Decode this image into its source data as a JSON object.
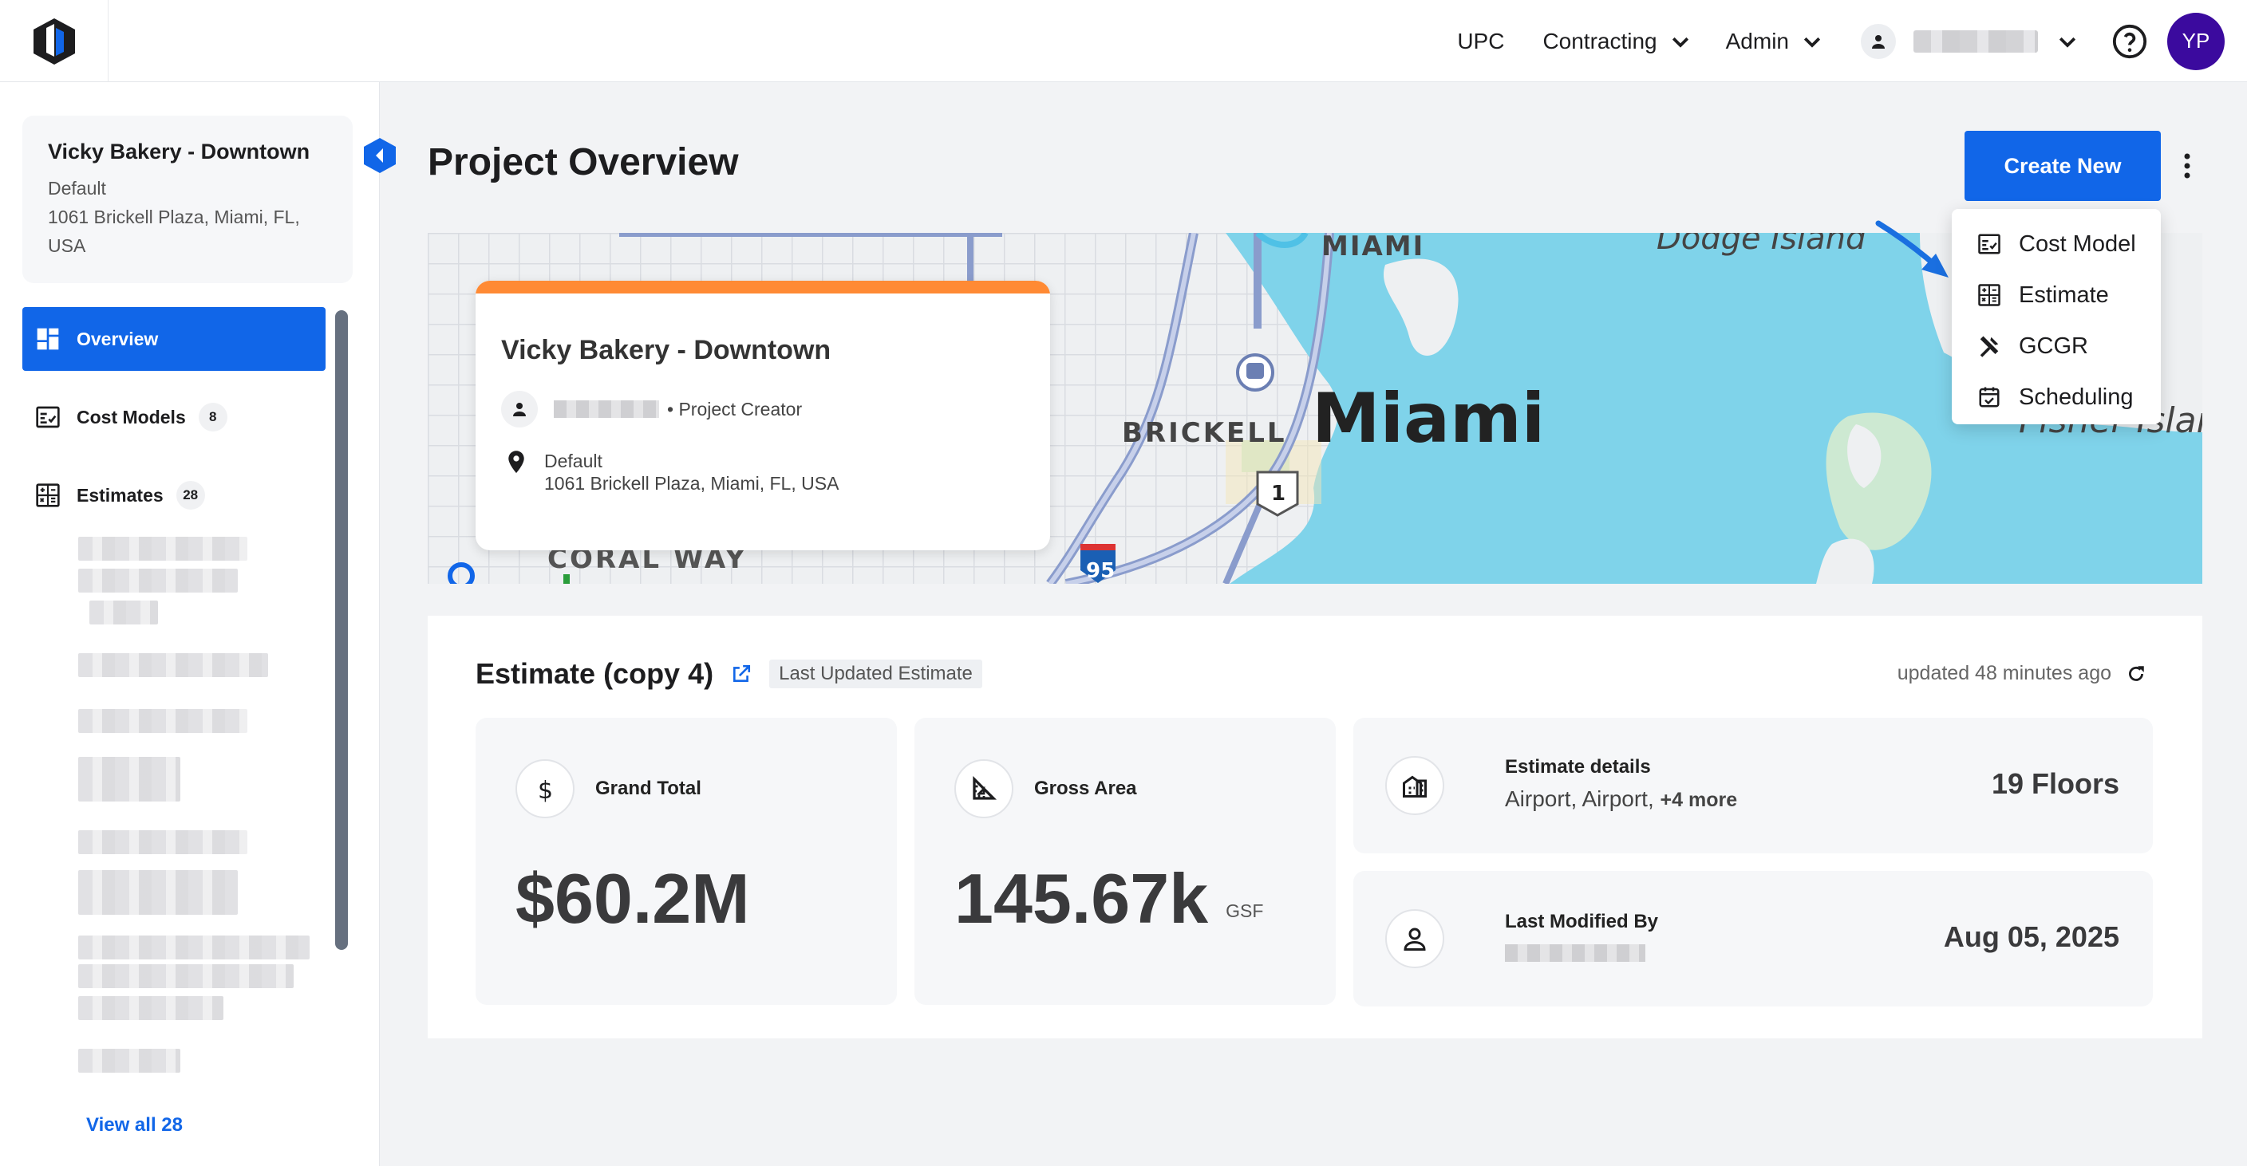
{
  "topbar": {
    "logo": "logo-icon",
    "nav": {
      "upc": "UPC",
      "contracting": "Contracting",
      "admin": "Admin"
    },
    "avatar_initials": "YP"
  },
  "sidebar": {
    "project": {
      "name": "Vicky Bakery - Downtown",
      "category": "Default",
      "address": "1061 Brickell Plaza, Miami, FL, USA"
    },
    "items": [
      {
        "label": "Overview"
      },
      {
        "label": "Cost Models",
        "count": "8"
      },
      {
        "label": "Estimates",
        "count": "28"
      }
    ],
    "view_all": "View all 28"
  },
  "main": {
    "title": "Project Overview",
    "create_new": "Create New",
    "dropdown": [
      {
        "label": "Cost Model",
        "icon": "cost-model-icon"
      },
      {
        "label": "Estimate",
        "icon": "estimate-icon"
      },
      {
        "label": "GCGR",
        "icon": "tools-icon"
      },
      {
        "label": "Scheduling",
        "icon": "calendar-icon"
      }
    ],
    "map": {
      "card_name": "Vicky Bakery - Downtown",
      "creator_role": "• Project Creator",
      "location_category": "Default",
      "location_address": "1061 Brickell Plaza, Miami, FL, USA",
      "labels": {
        "miami_top": "MIAMI",
        "dodge": "Dodge Island",
        "brickell": "BRICKELL",
        "miami_big": "Miami",
        "fisher": "Fisher Islar",
        "coral": "CORAL WAY",
        "route1": "1",
        "route95": "95"
      }
    },
    "estimate": {
      "title": "Estimate (copy 4)",
      "tag": "Last Updated Estimate",
      "updated": "updated 48 minutes ago",
      "grand_total_label": "Grand Total",
      "grand_total_value": "$60.2M",
      "gross_area_label": "Gross Area",
      "gross_area_value": "145.67k",
      "gross_area_unit": "GSF",
      "details_label": "Estimate details",
      "details_text": "Airport, Airport,",
      "details_more": "+4 more",
      "floors": "19 Floors",
      "modified_label": "Last Modified By",
      "modified_date": "Aug 05, 2025"
    }
  },
  "colors": {
    "primary": "#1166e8",
    "accent_orange": "#ff8a34",
    "avatar": "#3b0a9e",
    "water": "#7fd3ea"
  }
}
